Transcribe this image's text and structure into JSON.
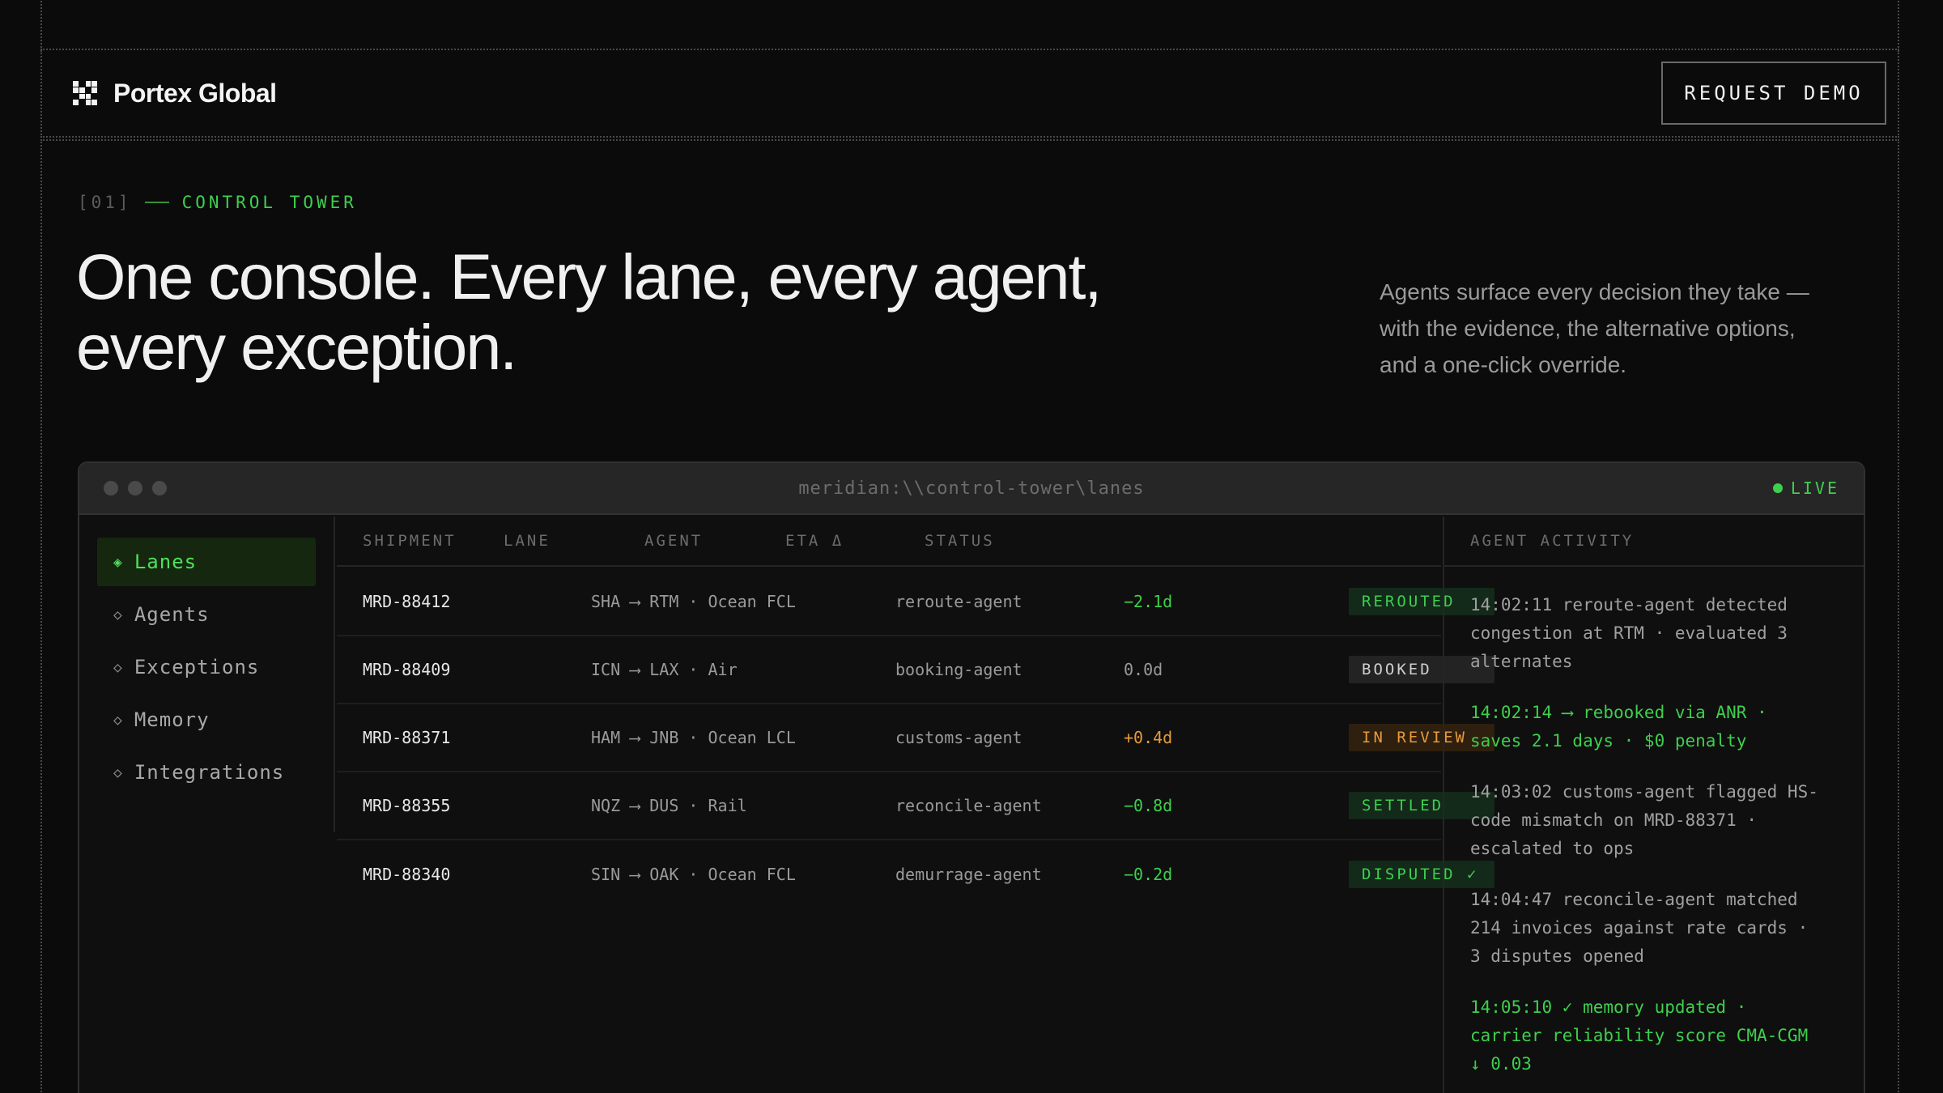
{
  "header": {
    "brand_name": "Portex Global",
    "cta_label": "REQUEST DEMO"
  },
  "hero": {
    "eyebrow_num": "[01]",
    "eyebrow_label": "CONTROL TOWER",
    "headline_line1": "One console. Every lane, every agent,",
    "headline_line2": "every exception.",
    "lede_line1": "Agents surface every decision they take —",
    "lede_line2": "with the evidence, the alternative options,",
    "lede_line3": "and a one-click override."
  },
  "console": {
    "path": "meridian:\\\\control-tower\\lanes",
    "live_label": "LIVE",
    "nav": [
      {
        "label": "Lanes",
        "mark": "◈",
        "active": true
      },
      {
        "label": "Agents",
        "mark": "◇",
        "active": false
      },
      {
        "label": "Exceptions",
        "mark": "◇",
        "active": false
      },
      {
        "label": "Memory",
        "mark": "◇",
        "active": false
      },
      {
        "label": "Integrations",
        "mark": "◇",
        "active": false
      }
    ],
    "columns": {
      "shipment": "SHIPMENT",
      "lane": "LANE",
      "agent": "AGENT",
      "eta": "ETA Δ",
      "status": "STATUS"
    },
    "rows": [
      {
        "shipment": "MRD-88412",
        "lane": "SHA ⟶ RTM · Ocean FCL",
        "agent": "reroute-agent",
        "eta": "−2.1d",
        "status": "REROUTED"
      },
      {
        "shipment": "MRD-88409",
        "lane": "ICN ⟶ LAX · Air",
        "agent": "booking-agent",
        "eta": "0.0d",
        "status": "BOOKED"
      },
      {
        "shipment": "MRD-88371",
        "lane": "HAM ⟶ JNB · Ocean LCL",
        "agent": "customs-agent",
        "eta": "+0.4d",
        "status": "IN REVIEW"
      },
      {
        "shipment": "MRD-88355",
        "lane": "NQZ ⟶ DUS · Rail",
        "agent": "reconcile-agent",
        "eta": "−0.8d",
        "status": "SETTLED"
      },
      {
        "shipment": "MRD-88340",
        "lane": "SIN ⟶ OAK · Ocean FCL",
        "agent": "demurrage-agent",
        "eta": "−0.2d",
        "status": "DISPUTED ✓"
      }
    ],
    "activity_title": "AGENT ACTIVITY",
    "activity": [
      {
        "lines": [
          "14:02:11 reroute-agent detected",
          "congestion at RTM · evaluated 3",
          "alternates"
        ]
      },
      {
        "lines": [
          "14:02:14 ⟶ rebooked via ANR ·",
          "saves 2.1 days · $0 penalty"
        ]
      },
      {
        "lines": [
          "14:03:02 customs-agent flagged HS-",
          "code mismatch on MRD-88371 ·",
          "escalated to ops"
        ]
      },
      {
        "lines": [
          "14:04:47 reconcile-agent matched",
          "214 invoices against rate cards ·",
          "3 disputes opened"
        ]
      },
      {
        "lines": [
          "14:05:10 ✓ memory updated ·",
          "carrier reliability score CMA-CGM",
          "↓ 0.03"
        ]
      }
    ]
  },
  "colors": {
    "accent": "#3ecf4e",
    "amber": "#e79a3b",
    "background": "#0b0b0b"
  }
}
